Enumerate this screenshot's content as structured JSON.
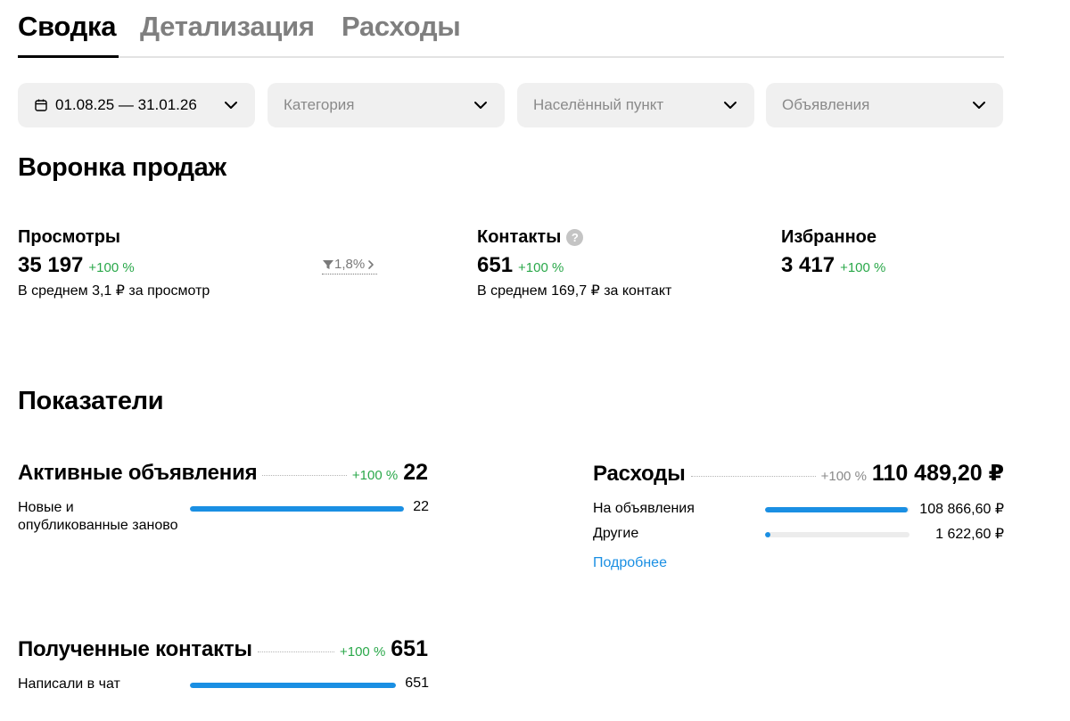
{
  "tabs": [
    {
      "label": "Сводка",
      "active": true
    },
    {
      "label": "Детализация",
      "active": false
    },
    {
      "label": "Расходы",
      "active": false
    }
  ],
  "filters": {
    "date": {
      "value": "01.08.25 — 31.01.26",
      "icon": "calendar-icon"
    },
    "category": {
      "placeholder": "Категория"
    },
    "locality": {
      "placeholder": "Населённый пункт"
    },
    "listings": {
      "placeholder": "Объявления"
    }
  },
  "funnel": {
    "title": "Воронка продаж",
    "views": {
      "label": "Просмотры",
      "value": "35 197",
      "delta": "+100 %",
      "sub": "В среднем 3,1 ₽ за просмотр"
    },
    "conversion": {
      "value": "1,8%",
      "icon": "funnel-icon"
    },
    "contacts": {
      "label": "Контакты",
      "help": "?",
      "value": "651",
      "delta": "+100 %",
      "sub": "В среднем 169,7 ₽ за контакт"
    },
    "favorites": {
      "label": "Избранное",
      "value": "3 417",
      "delta": "+100 %"
    }
  },
  "indicators": {
    "title": "Показатели",
    "active_listings": {
      "title": "Активные объявления",
      "delta": "+100 %",
      "value": "22",
      "rows": [
        {
          "label": "Новые и опубликованные заново",
          "value": "22",
          "fill": 1.0
        }
      ]
    },
    "expenses": {
      "title": "Расходы",
      "delta": "+100 %",
      "value": "110 489,20 ₽",
      "rows": [
        {
          "label": "На объявления",
          "value": "108 866,60 ₽",
          "fill": 0.985
        },
        {
          "label": "Другие",
          "value": "1 622,60 ₽",
          "fill": 0.04
        }
      ],
      "link": "Подробнее"
    },
    "received_contacts": {
      "title": "Полученные контакты",
      "delta": "+100 %",
      "value": "651",
      "rows": [
        {
          "label": "Написали в чат",
          "value": "651",
          "fill": 1.0
        }
      ]
    }
  },
  "colors": {
    "accent": "#1a8fe3",
    "positive": "#2aa84a",
    "muted": "#7f7f7f"
  }
}
